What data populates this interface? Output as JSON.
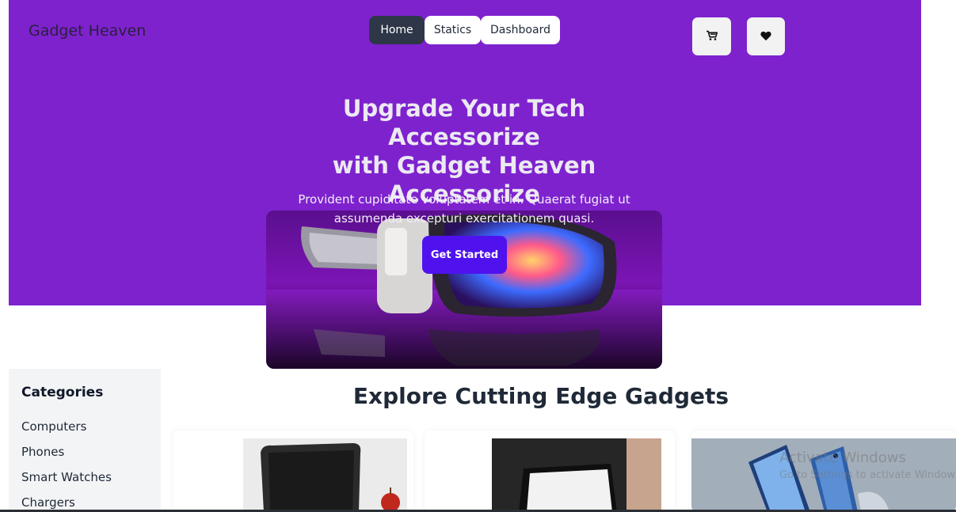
{
  "header": {
    "brand": "Gadget Heaven",
    "nav": [
      {
        "label": "Home",
        "active": true
      },
      {
        "label": "Statics",
        "active": false
      },
      {
        "label": "Dashboard",
        "active": false
      }
    ],
    "icons": {
      "cart": "cart-icon",
      "wishlist": "heart-icon"
    }
  },
  "hero": {
    "title_lines": [
      "Upgrade Your Tech Accessorize",
      "with Gadget Heaven",
      "Accessorize"
    ],
    "description_lines": [
      "Provident cupiditate voluptatem et in. Quaerat fugiat ut",
      "assumenda excepturi exercitationem quasi."
    ],
    "cta": "Get Started"
  },
  "sidebar": {
    "title": "Categories",
    "items": [
      "Computers",
      "Phones",
      "Smart Watches",
      "Chargers"
    ]
  },
  "main": {
    "title": "Explore Cutting Edge Gadgets"
  },
  "os_watermark": {
    "line1": "Activate Windows",
    "line2": "Go to Settings to activate Windows."
  },
  "colors": {
    "hero_bg": "#7e22ce",
    "cta_bg": "#4f12ee",
    "nav_active_bg": "#2d3748",
    "sidebar_bg": "#f3f4f6"
  }
}
